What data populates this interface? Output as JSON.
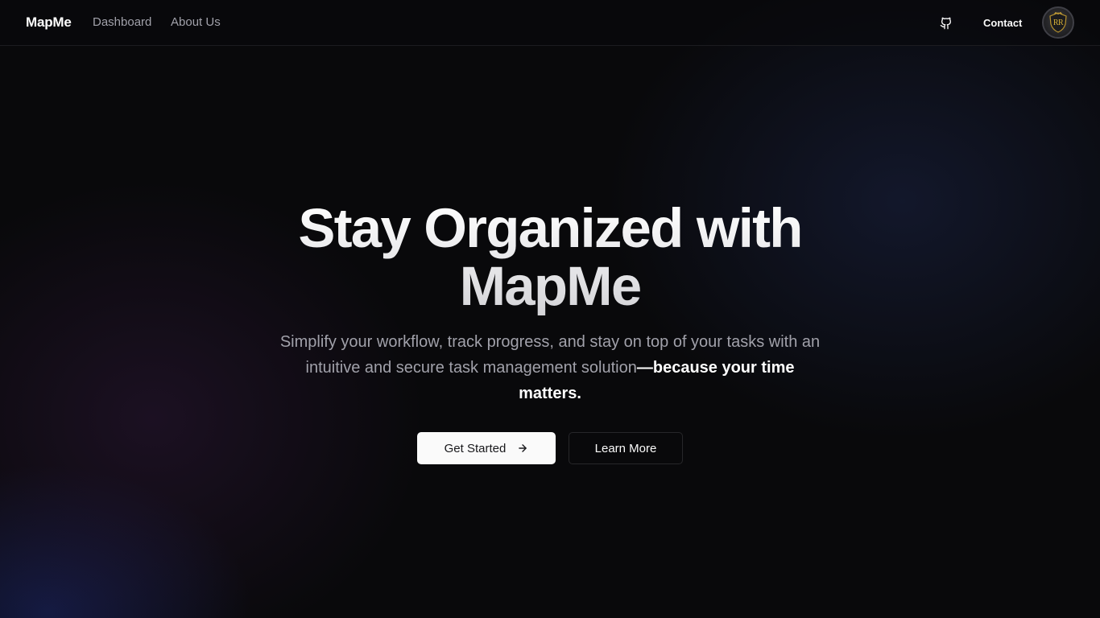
{
  "header": {
    "brand": "MapMe",
    "nav": {
      "dashboard": "Dashboard",
      "about": "About Us"
    },
    "github_icon": "github-icon",
    "contact_label": "Contact",
    "avatar_initials": "RR"
  },
  "hero": {
    "title_line1": "Stay Organized with",
    "title_line2": "MapMe",
    "subtitle_plain": "Simplify your workflow, track progress, and stay on top of your tasks with an intuitive and secure task management solution",
    "subtitle_strong": "—because your time matters.",
    "cta_primary": "Get Started",
    "cta_primary_icon": "arrow-right-icon",
    "cta_secondary": "Learn More"
  },
  "colors": {
    "background": "#09090b",
    "primary_button": "#fafafa",
    "muted_text": "#a1a1aa"
  }
}
